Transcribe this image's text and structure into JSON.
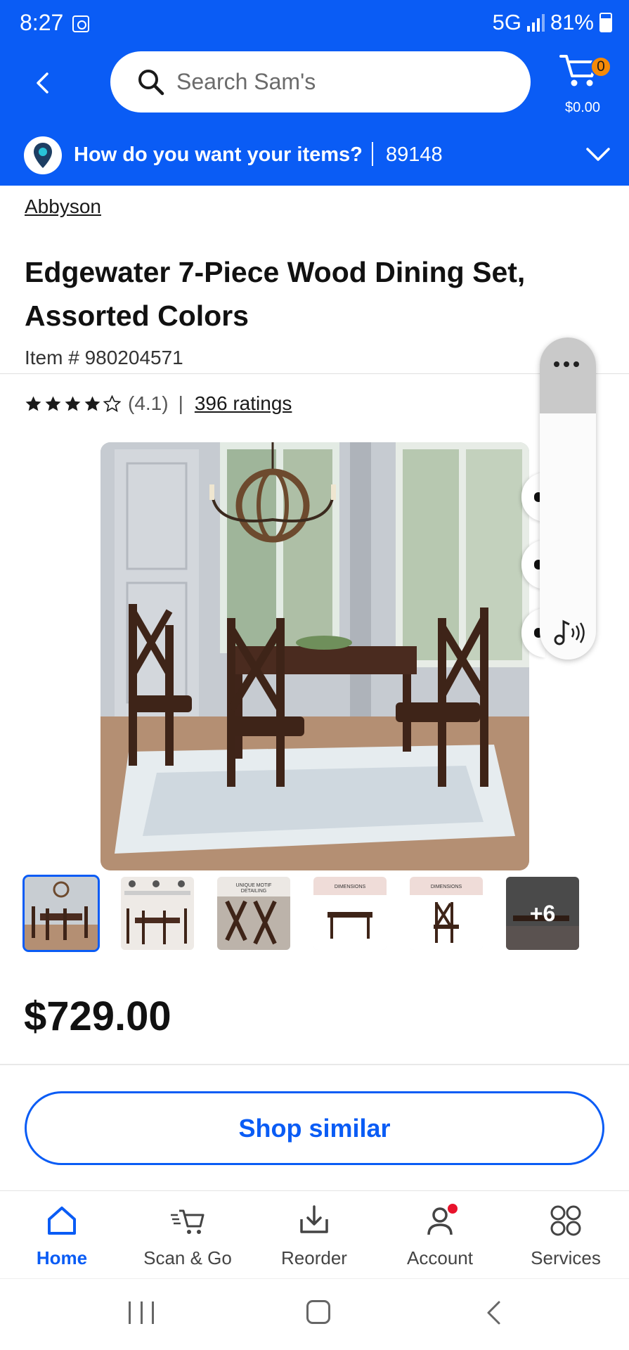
{
  "status_bar": {
    "time": "8:27",
    "network": "5G",
    "battery": "81%"
  },
  "header": {
    "search_placeholder": "Search Sam's",
    "cart_count": "0",
    "cart_total": "$0.00",
    "delivery_question": "How do you want your items?",
    "zip": "89148",
    "accent_color": "#0a5cf5"
  },
  "product": {
    "brand": "Abbyson",
    "title": "Edgewater 7-Piece Wood Dining Set, Assorted Colors",
    "item_number": "Item # 980204571",
    "rating_value": "(4.1)",
    "rating_stars": 4.1,
    "rating_separator": "|",
    "ratings_count": "396 ratings",
    "thumbnails": [
      {
        "label": "",
        "icon": "dining-set-photo"
      },
      {
        "label": "",
        "icon": "features-infographic"
      },
      {
        "label": "UNIQUE MOTIF DETAILING",
        "icon": "chair-detail"
      },
      {
        "label": "DIMENSIONS",
        "icon": "table-dimensions"
      },
      {
        "label": "DIMENSIONS",
        "icon": "chair-dimensions"
      },
      {
        "label": "+6",
        "icon": "more-images"
      }
    ],
    "price": "$729.00"
  },
  "actions": {
    "shop_similar": "Shop similar"
  },
  "bottom_nav": [
    {
      "label": "Home",
      "icon": "home-icon",
      "active": true
    },
    {
      "label": "Scan & Go",
      "icon": "scan-cart-icon",
      "active": false
    },
    {
      "label": "Reorder",
      "icon": "reorder-icon",
      "active": false
    },
    {
      "label": "Account",
      "icon": "account-icon",
      "active": false
    },
    {
      "label": "Services",
      "icon": "services-icon",
      "active": false
    }
  ]
}
